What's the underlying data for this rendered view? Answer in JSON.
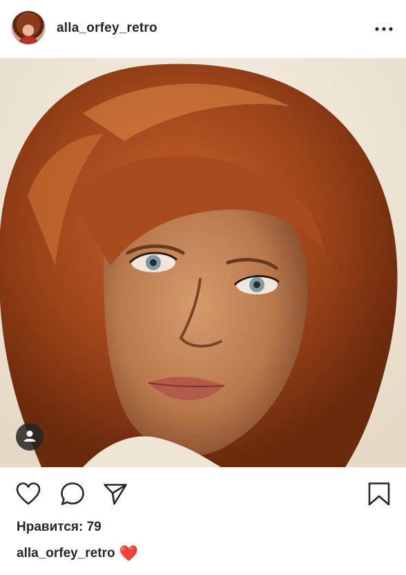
{
  "post": {
    "username": "alla_orfey_retro",
    "likes_text": "Нравится: 79",
    "caption_username": "alla_orfey_retro",
    "caption_emoji": "❤️"
  },
  "icons": {
    "more": "more-horizontal-icon",
    "like": "heart-outline-icon",
    "comment": "comment-bubble-icon",
    "share": "paper-plane-icon",
    "save": "bookmark-icon",
    "tag": "user-tag-icon"
  },
  "colors": {
    "text": "#262626",
    "heart_emoji": "#d7263d",
    "tag_badge": "#262626"
  }
}
